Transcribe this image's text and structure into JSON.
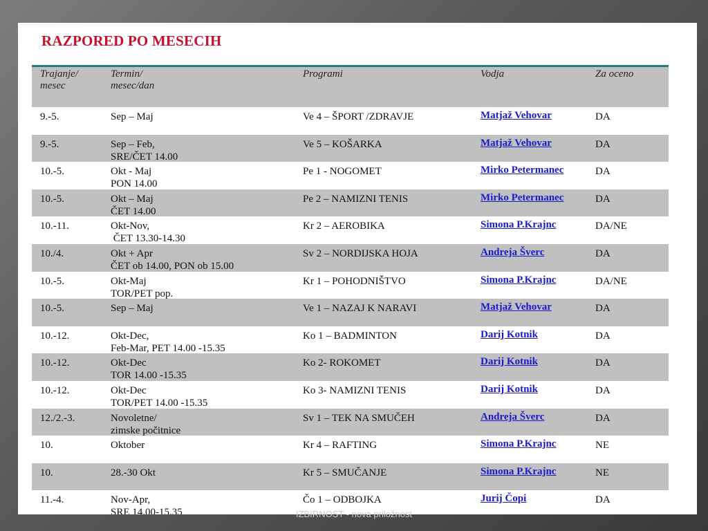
{
  "title": "RAZPORED PO MESECIH",
  "headers": [
    {
      "line1": "Trajanje/",
      "line2": "mesec"
    },
    {
      "line1": "Termin/",
      "line2": "mesec/dan"
    },
    {
      "line1": "Programi",
      "line2": ""
    },
    {
      "line1": "Vodja",
      "line2": ""
    },
    {
      "line1": "Za oceno",
      "line2": ""
    }
  ],
  "rows": [
    {
      "duration": "9.-5.",
      "term": "Sep – Maj",
      "program": "Ve 4 – ŠPORT /ZDRAVJE",
      "leader": "Matjaž Vehovar",
      "grade": "DA"
    },
    {
      "duration": "9.-5.",
      "term": "Sep – Feb,\nSRE/ČET 14.00",
      "program": "Ve 5 – KOŠARKA",
      "leader": "Matjaž Vehovar",
      "grade": "DA"
    },
    {
      "duration": "10.-5.",
      "term": "Okt - Maj\nPON 14.00",
      "program": "Pe 1 - NOGOMET",
      "leader": "Mirko Petermanec",
      "grade": "DA"
    },
    {
      "duration": "10.-5.",
      "term": "Okt – Maj\nČET 14.00",
      "program": "Pe 2 – NAMIZNI TENIS",
      "leader": "Mirko Petermanec",
      "grade": "DA"
    },
    {
      "duration": "10.-11.",
      "term": "Okt-Nov,\n ČET 13.30-14.30",
      "program": "Kr 2 – AEROBIKA",
      "leader": "Simona P.Krajnc",
      "grade": "DA/NE"
    },
    {
      "duration": "10./4.",
      "term": "Okt + Apr\nČET ob 14.00, PON ob 15.00",
      "program": "Sv 2 – NORDIJSKA HOJA",
      "leader": "Andreja Šverc",
      "grade": "DA"
    },
    {
      "duration": "10.-5.",
      "term": "Okt-Maj\nTOR/PET pop.",
      "program": "Kr 1 – POHODNIŠTVO",
      "leader": "Simona P.Krajnc",
      "grade": "DA/NE"
    },
    {
      "duration": "10.-5.",
      "term": "Sep – Maj",
      "program": "Ve 1 – NAZAJ K NARAVI",
      "leader": "Matjaž Vehovar",
      "grade": "DA"
    },
    {
      "duration": "10.-12.",
      "term": "Okt-Dec,\nFeb-Mar, PET 14.00 -15.35",
      "program": "Ko 1 – BADMINTON",
      "leader": "Darij Kotnik",
      "grade": "DA"
    },
    {
      "duration": "10.-12.",
      "term": "Okt-Dec\nTOR 14.00 -15.35",
      "program": "Ko 2- ROKOMET",
      "leader": "Darij Kotnik",
      "grade": "DA"
    },
    {
      "duration": "10.-12.",
      "term": "Okt-Dec\nTOR/PET 14.00 -15.35",
      "program": "Ko 3- NAMIZNI TENIS",
      "leader": "Darij Kotnik",
      "grade": "DA"
    },
    {
      "duration": "12./2.-3.",
      "term": "Novoletne/\nzimske počitnice",
      "program": "Sv 1 – TEK NA SMUČEH",
      "leader": "Andreja Šverc",
      "grade": "DA"
    },
    {
      "duration": "10.",
      "term": "Oktober",
      "program": "Kr 4 – RAFTING",
      "leader": "Simona P.Krajnc",
      "grade": "NE"
    },
    {
      "duration": "10.",
      "term": "28.-30 Okt",
      "program": "Kr 5 – SMUČANJE",
      "leader": "Simona P.Krajnc",
      "grade": "NE"
    },
    {
      "duration": "11.-4.",
      "term": "Nov-Apr,\nSRE 14.00-15.35",
      "program": "Čo 1 – ODBOJKA",
      "leader": "Jurij Čopi",
      "grade": "DA"
    }
  ],
  "footer": "IZBIRNOST - nova priložnost",
  "colors": {
    "title": "#c8102e",
    "header_border": "#1f7f80",
    "link": "#1a1acc",
    "band": "#c0c0c0"
  }
}
